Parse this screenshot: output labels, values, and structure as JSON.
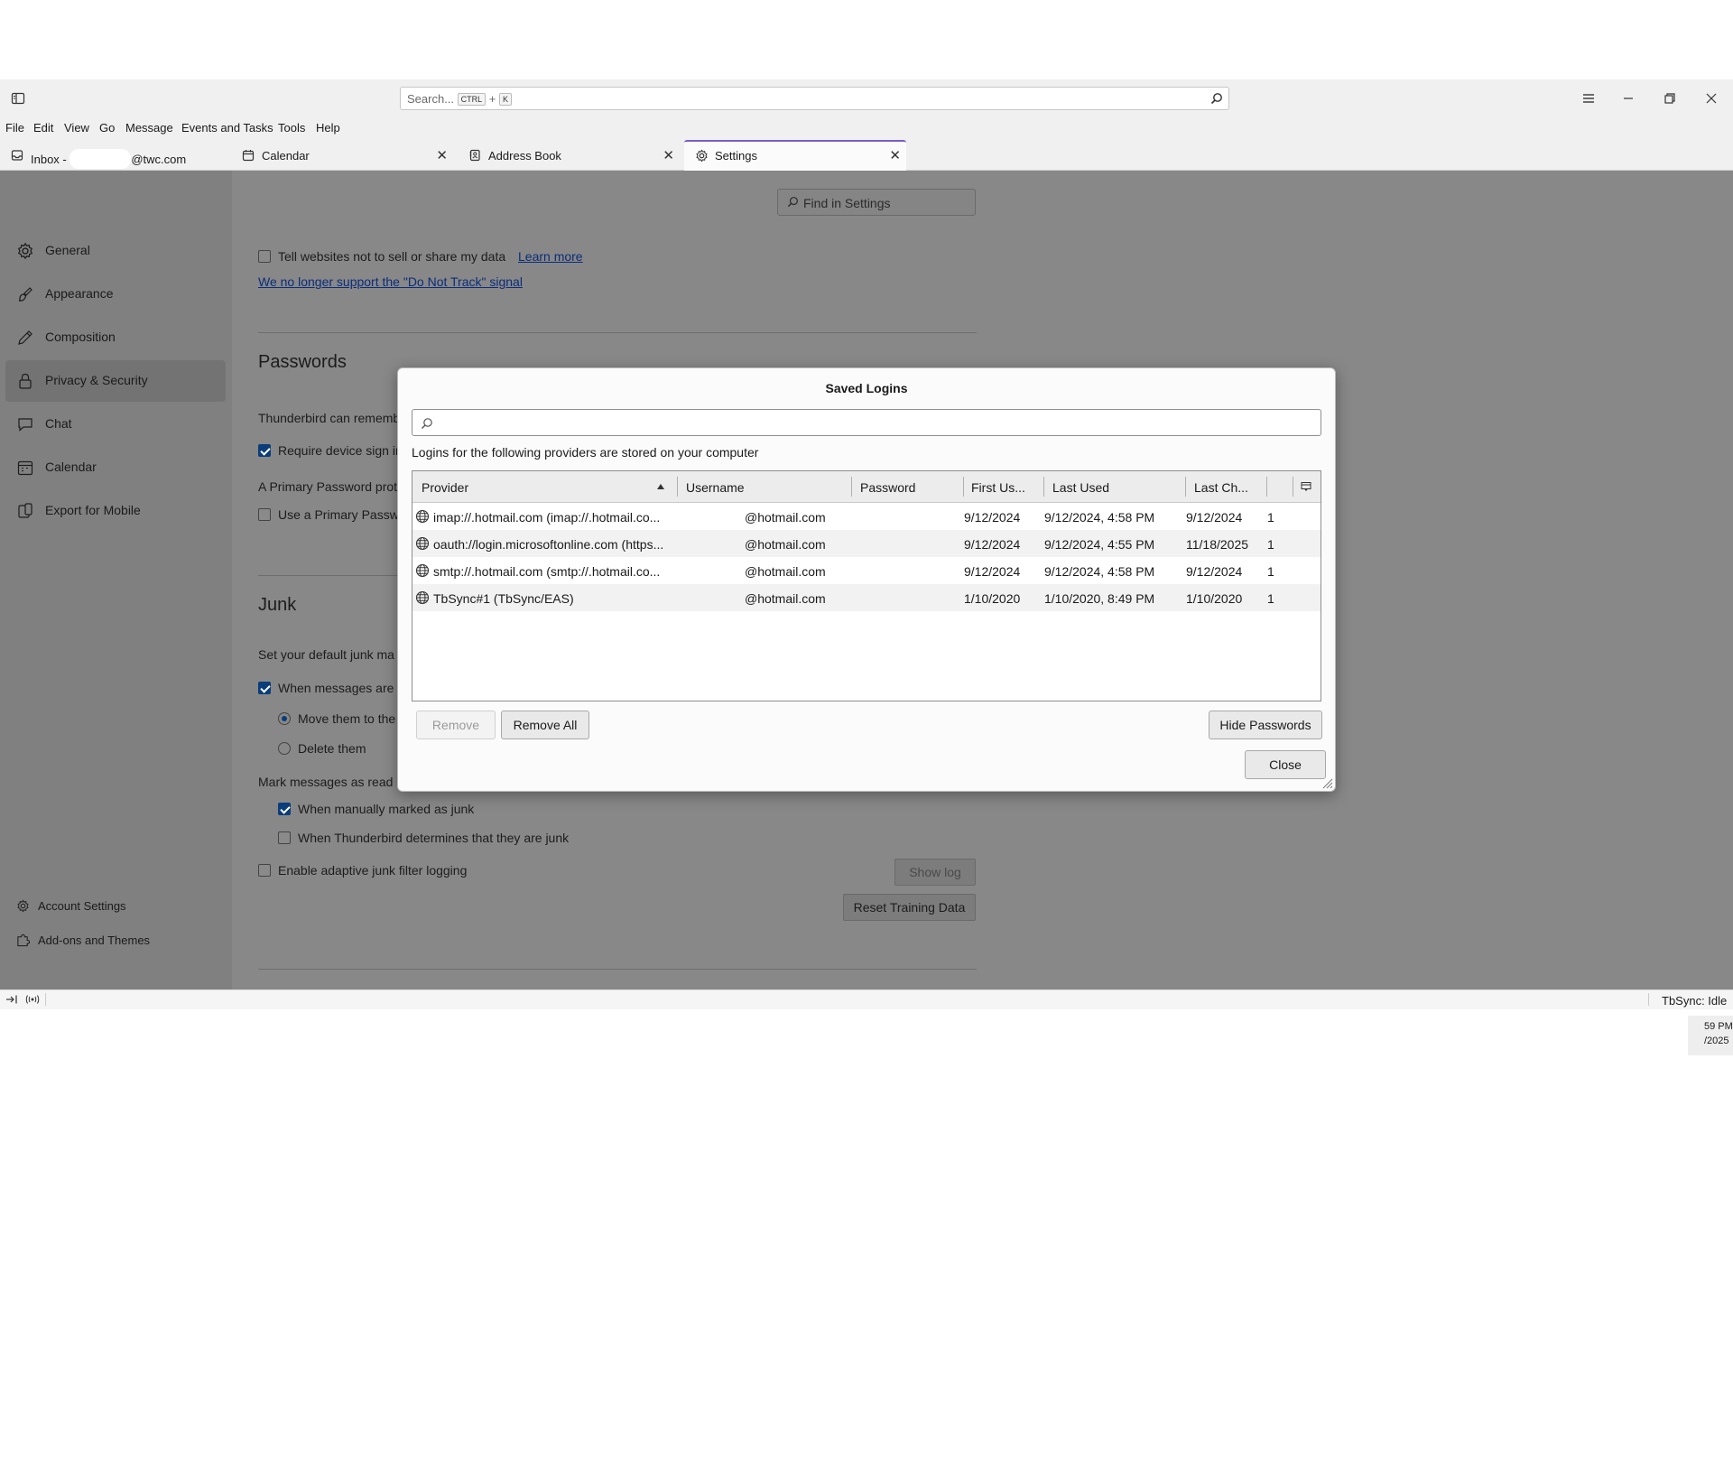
{
  "titlebar": {
    "search_placeholder": "Search...",
    "search_key_1": "CTRL",
    "search_key_plus": "+",
    "search_key_2": "K"
  },
  "menubar": {
    "items": [
      "File",
      "Edit",
      "View",
      "Go",
      "Message",
      "Events and Tasks",
      "Tools",
      "Help"
    ]
  },
  "tabs": [
    {
      "label": "Inbox - ",
      "suffix": "@twc.com",
      "icon": "inbox-icon"
    },
    {
      "label": "Calendar",
      "icon": "calendar-icon"
    },
    {
      "label": "Address Book",
      "icon": "address-book-icon"
    },
    {
      "label": "Settings",
      "icon": "gear-icon",
      "selected": true
    }
  ],
  "settings": {
    "find_placeholder": "Find in Settings",
    "nav": [
      {
        "label": "General",
        "icon": "gear-icon"
      },
      {
        "label": "Appearance",
        "icon": "brush-icon"
      },
      {
        "label": "Composition",
        "icon": "pencil-icon"
      },
      {
        "label": "Privacy & Security",
        "icon": "lock-icon",
        "active": true
      },
      {
        "label": "Chat",
        "icon": "chat-icon"
      },
      {
        "label": "Calendar",
        "icon": "calendar-icon"
      },
      {
        "label": "Export for Mobile",
        "icon": "mobile-icon"
      }
    ],
    "footer": {
      "account_settings": "Account Settings",
      "addons": "Add-ons and Themes"
    },
    "privacy": {
      "dnt_label": "Tell websites not to sell or share my data",
      "learn_more": "Learn more",
      "dnt_link": "We no longer support the \"Do Not Track\" signal"
    },
    "passwords": {
      "heading": "Passwords",
      "line1": "Thunderbird can rememb",
      "require_sign_in": "Require device sign in",
      "primary_desc": "A Primary Password prot",
      "use_primary": "Use a Primary Passwo"
    },
    "junk": {
      "heading": "Junk",
      "default_text": "Set your default junk ma",
      "when_messages": "When messages are m",
      "move_them": "Move them to the",
      "delete_them": "Delete them",
      "mark_read": "Mark messages as read",
      "manually": "When manually marked as junk",
      "determines": "When Thunderbird determines that they are junk",
      "logging": "Enable adaptive junk filter logging",
      "show_log": "Show log",
      "reset": "Reset Training Data"
    }
  },
  "dialog": {
    "title": "Saved Logins",
    "intro": "Logins for the following providers are stored on your computer",
    "columns": [
      "Provider",
      "Username",
      "Password",
      "First Us...",
      "Last Used",
      "Last Ch...",
      ""
    ],
    "rows": [
      {
        "provider": "imap://.hotmail.com (imap://.hotmail.co...",
        "username": "@hotmail.com",
        "password": "",
        "first_used": "9/12/2024",
        "last_used": "9/12/2024, 4:58 PM",
        "last_changed": "9/12/2024",
        "count": "1"
      },
      {
        "provider": "oauth://login.microsoftonline.com (https...",
        "username": "@hotmail.com",
        "password": "",
        "first_used": "9/12/2024",
        "last_used": "9/12/2024, 4:55 PM",
        "last_changed": "11/18/2025",
        "count": "1"
      },
      {
        "provider": "smtp://.hotmail.com (smtp://.hotmail.co...",
        "username": "@hotmail.com",
        "password": "",
        "first_used": "9/12/2024",
        "last_used": "9/12/2024, 4:58 PM",
        "last_changed": "9/12/2024",
        "count": "1"
      },
      {
        "provider": "TbSync#1 (TbSync/EAS)",
        "username": "@hotmail.com",
        "password": "",
        "first_used": "1/10/2020",
        "last_used": "1/10/2020, 8:49 PM",
        "last_changed": "1/10/2020",
        "count": "1"
      }
    ],
    "remove": "Remove",
    "remove_all": "Remove All",
    "hide_passwords": "Hide Passwords",
    "close": "Close"
  },
  "statusbar": {
    "tbsync": "TbSync: Idle"
  },
  "tray": {
    "time": "59 PM",
    "date": "/2025"
  }
}
